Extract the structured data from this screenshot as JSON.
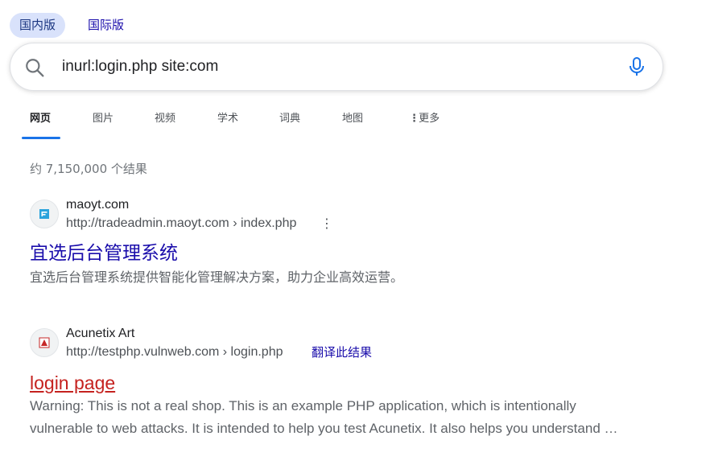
{
  "region_tabs": {
    "domestic": "国内版",
    "international": "国际版"
  },
  "search": {
    "query": "inurl:login.php site:com"
  },
  "nav": {
    "tabs": [
      "网页",
      "图片",
      "视频",
      "学术",
      "词典",
      "地图"
    ],
    "more_label": "更多",
    "active": "网页"
  },
  "results_count": "约 7,150,000 个结果",
  "results": [
    {
      "site_name": "maoyt.com",
      "url": "http://tradeadmin.maoyt.com › index.php",
      "title": "宜选后台管理系统",
      "snippet": "宜选后台管理系统提供智能化管理解决方案，助力企业高效运营。"
    },
    {
      "site_name": "Acunetix Art",
      "url": "http://testphp.vulnweb.com › login.php",
      "translate_label": "翻译此结果",
      "title": "login page",
      "snippet_line1": "Warning: This is not a real shop. This is an example PHP application, which is intentionally",
      "snippet_line2": "vulnerable to web attacks. It is intended to help you test Acunetix. It also helps you understand …"
    }
  ],
  "colors": {
    "link": "#1a0dab",
    "visited_red": "#c5221f",
    "accent_blue": "#1a73e8",
    "region_active_bg": "#d9e2fb"
  },
  "icons": [
    "search-icon",
    "mic-icon",
    "more-vertical-icon",
    "site-favicon"
  ]
}
